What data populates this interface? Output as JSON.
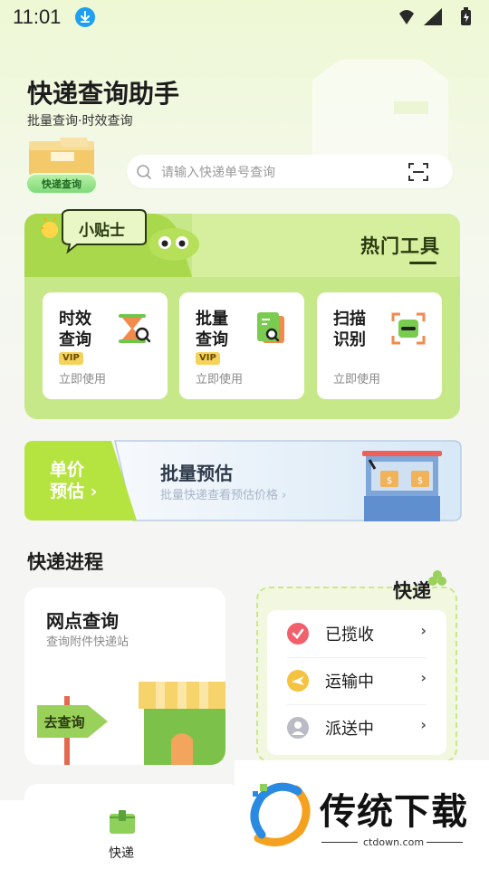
{
  "status_bar": {
    "time": "11:01"
  },
  "header": {
    "title": "快递查询助手",
    "subtitle": "批量查询·时效查询",
    "tag": "快递查询"
  },
  "search": {
    "placeholder": "请输入快递单号查询"
  },
  "tools": {
    "heading": "热门工具",
    "badge": "小贴士",
    "items": [
      {
        "name": "时效查询",
        "vip": "VIP",
        "action": "立即使用",
        "icon": "hourglass-search-icon"
      },
      {
        "name": "批量查询",
        "vip": "VIP",
        "action": "立即使用",
        "icon": "document-search-icon"
      },
      {
        "name": "扫描识别",
        "vip": "",
        "action": "立即使用",
        "icon": "scan-frame-icon"
      }
    ]
  },
  "estimate": {
    "unit_label": "单价预估",
    "unit_arrow": "›",
    "title": "批量预估",
    "subtitle": "批量快递查看预估价格 ›"
  },
  "progress": {
    "section_title": "快递进程",
    "station": {
      "title": "网点查询",
      "subtitle": "查询附件快递站",
      "sign": "去查询"
    },
    "status_heading": "快递",
    "statuses": [
      {
        "label": "已揽收",
        "icon": "check-circle-icon",
        "color": "#f2616b"
      },
      {
        "label": "运输中",
        "icon": "plane-circle-icon",
        "color": "#f5c242"
      },
      {
        "label": "派送中",
        "icon": "person-circle-icon",
        "color": "#b9bcc4"
      }
    ],
    "chevron": "›"
  },
  "bottom_nav": {
    "items": [
      {
        "label": "快递",
        "icon": "package-icon"
      }
    ]
  },
  "watermark": {
    "text": "传统下载",
    "url": "ctdown.com"
  },
  "colors": {
    "accent_green": "#c7e888",
    "dark_green": "#2a3a10",
    "tag_green": "#7fd97a"
  }
}
